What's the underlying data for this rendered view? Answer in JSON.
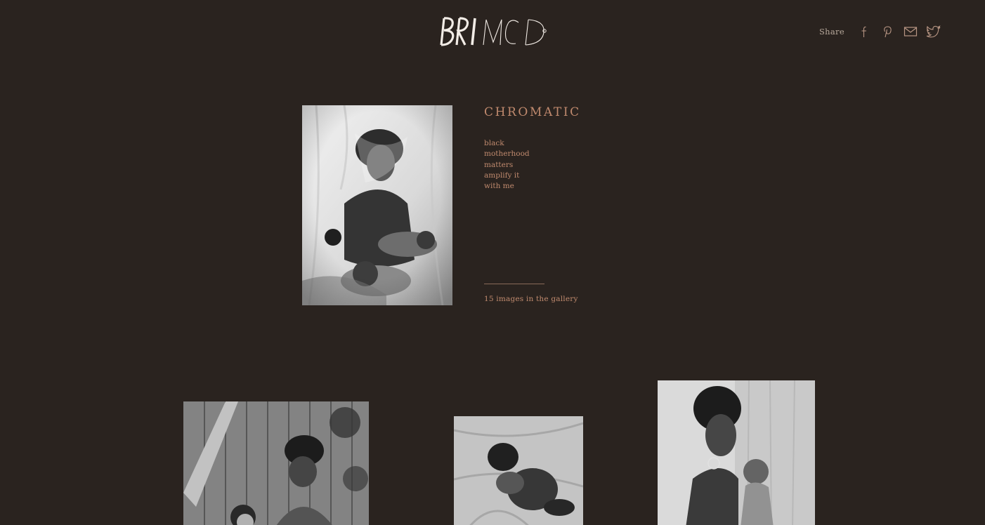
{
  "header": {
    "logo_text": "BRIMCD",
    "share_label": "Share",
    "social_icons": [
      "facebook-icon",
      "pinterest-icon",
      "mail-icon",
      "twitter-icon"
    ]
  },
  "gallery": {
    "title": "CHROMATIC",
    "description_lines": [
      "black",
      "motherhood",
      "matters",
      "amplify it",
      "with me"
    ],
    "image_count_text": "15 images in the gallery"
  },
  "colors": {
    "background": "#2a231f",
    "accent": "#c08a6e",
    "muted_text": "#b7a89b"
  }
}
